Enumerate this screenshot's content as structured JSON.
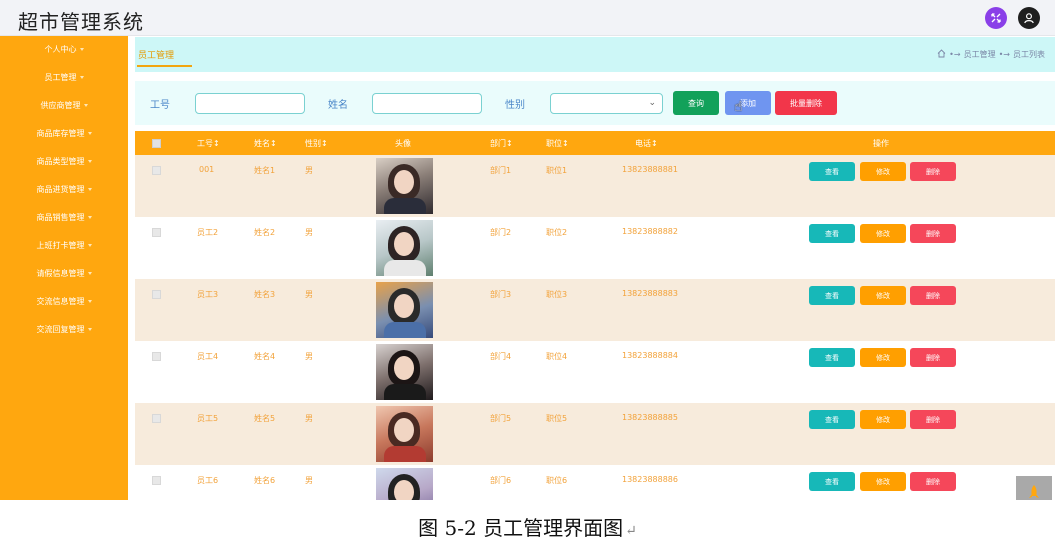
{
  "app": {
    "title": "超市管理系统"
  },
  "sidebar": {
    "items": [
      {
        "label": "个人中心"
      },
      {
        "label": "员工管理"
      },
      {
        "label": "供应商管理"
      },
      {
        "label": "商品库存管理"
      },
      {
        "label": "商品类型管理"
      },
      {
        "label": "商品进货管理"
      },
      {
        "label": "商品销售管理"
      },
      {
        "label": "上班打卡管理"
      },
      {
        "label": "请假信息管理"
      },
      {
        "label": "交流信息管理"
      },
      {
        "label": "交流回复管理"
      }
    ]
  },
  "tabs": {
    "active": "员工管理"
  },
  "breadcrumb": {
    "path": [
      "员工管理",
      "员工列表"
    ]
  },
  "search": {
    "label_id": "工号",
    "label_name": "姓名",
    "label_gender": "性别",
    "id_value": "",
    "name_value": "",
    "gender_value": ""
  },
  "buttons": {
    "query": "查询",
    "add": "添加",
    "batch_delete": "批量删除"
  },
  "table": {
    "headers": [
      "工号",
      "姓名",
      "性别",
      "头像",
      "部门",
      "职位",
      "电话",
      "操作"
    ],
    "sort_icon": "↕",
    "actions": {
      "view": "查看",
      "edit": "修改",
      "delete": "删除"
    },
    "rows": [
      {
        "id": "001",
        "name": "姓名1",
        "gender": "男",
        "dept": "部门1",
        "position": "职位1",
        "phone": "13823888881"
      },
      {
        "id": "员工2",
        "name": "姓名2",
        "gender": "男",
        "dept": "部门2",
        "position": "职位2",
        "phone": "13823888882"
      },
      {
        "id": "员工3",
        "name": "姓名3",
        "gender": "男",
        "dept": "部门3",
        "position": "职位3",
        "phone": "13823888883"
      },
      {
        "id": "员工4",
        "name": "姓名4",
        "gender": "男",
        "dept": "部门4",
        "position": "职位4",
        "phone": "13823888884"
      },
      {
        "id": "员工5",
        "name": "姓名5",
        "gender": "男",
        "dept": "部门5",
        "position": "职位5",
        "phone": "13823888885"
      },
      {
        "id": "员工6",
        "name": "姓名6",
        "gender": "男",
        "dept": "部门6",
        "position": "职位6",
        "phone": "13823888886"
      }
    ]
  },
  "caption": "图 5-2 员工管理界面图",
  "colors": {
    "accent_orange": "#ffa70f",
    "query_green": "#12a15a",
    "add_blue": "#6f95f0",
    "delete_red": "#f2364a",
    "view_teal": "#17b8b8"
  }
}
